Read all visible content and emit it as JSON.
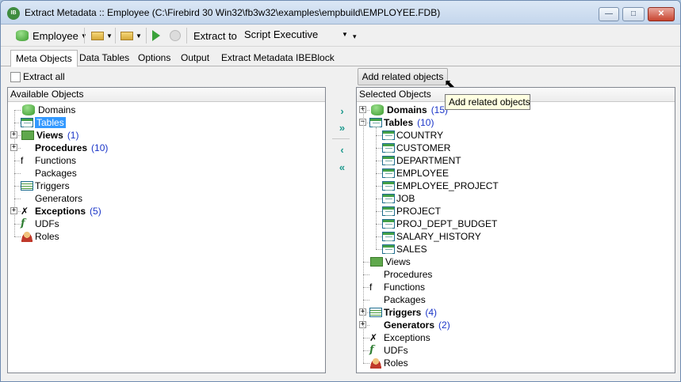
{
  "window": {
    "title": "Extract Metadata :: Employee (C:\\Firebird 30 Win32\\fb3w32\\examples\\empbuild\\EMPLOYEE.FDB)",
    "app_icon_text": "IB"
  },
  "titlebar_buttons": {
    "minimize": "—",
    "maximize": "□",
    "close": "✕"
  },
  "toolbar": {
    "database_label": "Employee",
    "extract_to_label": "Extract to",
    "extract_to_value": "Script Executive"
  },
  "tabs": [
    "Meta Objects",
    "Data Tables",
    "Options",
    "Output",
    "Extract Metadata IBEBlock"
  ],
  "extract_all_label": "Extract all",
  "add_related_button": "Add related objects",
  "tooltip": "Add related objects",
  "left_panel": {
    "header": "Available Objects",
    "nodes": [
      {
        "label": "Domains",
        "icon": "domains-icon",
        "count": "",
        "bold": false,
        "expander": false,
        "selected": false
      },
      {
        "label": "Tables",
        "icon": "tables-icon",
        "count": "",
        "bold": false,
        "expander": false,
        "selected": true
      },
      {
        "label": "Views",
        "icon": "views-icon",
        "count": "(1)",
        "bold": true,
        "expander": true,
        "selected": false
      },
      {
        "label": "Procedures",
        "icon": "procedures-icon",
        "count": "(10)",
        "bold": true,
        "expander": true,
        "selected": false
      },
      {
        "label": "Functions",
        "icon": "functions-icon",
        "count": "",
        "bold": false,
        "expander": false,
        "selected": false
      },
      {
        "label": "Packages",
        "icon": "packages-icon",
        "count": "",
        "bold": false,
        "expander": false,
        "selected": false
      },
      {
        "label": "Triggers",
        "icon": "triggers-icon",
        "count": "",
        "bold": false,
        "expander": false,
        "selected": false
      },
      {
        "label": "Generators",
        "icon": "generators-icon",
        "count": "",
        "bold": false,
        "expander": false,
        "selected": false
      },
      {
        "label": "Exceptions",
        "icon": "exceptions-icon",
        "count": "(5)",
        "bold": true,
        "expander": true,
        "selected": false
      },
      {
        "label": "UDFs",
        "icon": "udfs-icon",
        "count": "",
        "bold": false,
        "expander": false,
        "selected": false
      },
      {
        "label": "Roles",
        "icon": "roles-icon",
        "count": "",
        "bold": false,
        "expander": false,
        "selected": false
      }
    ]
  },
  "transfer_buttons": {
    "add": "›",
    "add_all": "»",
    "remove": "‹",
    "remove_all": "«"
  },
  "right_panel": {
    "header": "Selected Objects",
    "nodes": [
      {
        "label": "Domains",
        "icon": "domains-icon",
        "count": "(15)",
        "bold": true,
        "expander": "+"
      },
      {
        "label": "Tables",
        "icon": "tables-icon",
        "count": "(10)",
        "bold": true,
        "expander": "-"
      },
      {
        "label": "Views",
        "icon": "views-icon",
        "count": "",
        "bold": false,
        "expander": ""
      },
      {
        "label": "Procedures",
        "icon": "procedures-icon",
        "count": "",
        "bold": false,
        "expander": ""
      },
      {
        "label": "Functions",
        "icon": "functions-icon",
        "count": "",
        "bold": false,
        "expander": ""
      },
      {
        "label": "Packages",
        "icon": "packages-icon",
        "count": "",
        "bold": false,
        "expander": ""
      },
      {
        "label": "Triggers",
        "icon": "triggers-icon",
        "count": "(4)",
        "bold": true,
        "expander": "+"
      },
      {
        "label": "Generators",
        "icon": "generators-icon",
        "count": "(2)",
        "bold": true,
        "expander": "+"
      },
      {
        "label": "Exceptions",
        "icon": "exceptions-icon",
        "count": "",
        "bold": false,
        "expander": ""
      },
      {
        "label": "UDFs",
        "icon": "udfs-icon",
        "count": "",
        "bold": false,
        "expander": ""
      },
      {
        "label": "Roles",
        "icon": "roles-icon",
        "count": "",
        "bold": false,
        "expander": ""
      }
    ],
    "tables_children": [
      "COUNTRY",
      "CUSTOMER",
      "DEPARTMENT",
      "EMPLOYEE",
      "EMPLOYEE_PROJECT",
      "JOB",
      "PROJECT",
      "PROJ_DEPT_BUDGET",
      "SALARY_HISTORY",
      "SALES"
    ]
  },
  "colors": {
    "selection": "#3399ff",
    "count": "#1a35c8",
    "arrows": "#1f9a8e"
  }
}
